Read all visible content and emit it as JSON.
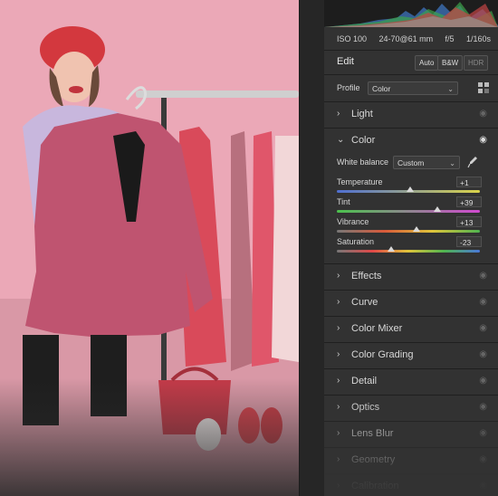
{
  "camera_meta": {
    "iso": "ISO 100",
    "lens": "24-70@61 mm",
    "aperture": "f/5",
    "shutter": "1/160s"
  },
  "edit": {
    "title": "Edit",
    "auto_label": "Auto",
    "bw_label": "B&W",
    "hdr_label": "HDR"
  },
  "profile": {
    "label": "Profile",
    "value": "Color"
  },
  "sections": {
    "light": "Light",
    "color": "Color",
    "effects": "Effects",
    "curve": "Curve",
    "color_mixer": "Color Mixer",
    "color_grading": "Color Grading",
    "detail": "Detail",
    "optics": "Optics",
    "lens_blur": "Lens Blur",
    "geometry": "Geometry",
    "calibration": "Calibration"
  },
  "white_balance": {
    "label": "White balance",
    "value": "Custom"
  },
  "sliders": [
    {
      "label": "Temperature",
      "value": "+1",
      "position": 0.51
    },
    {
      "label": "Tint",
      "value": "+39",
      "position": 0.7
    },
    {
      "label": "Vibrance",
      "value": "+13",
      "position": 0.56
    },
    {
      "label": "Saturation",
      "value": "-23",
      "position": 0.38
    }
  ],
  "colors": {
    "panel_bg": "#323232",
    "photo_bg": "#e9a7b5",
    "dress": "#c0506b"
  }
}
